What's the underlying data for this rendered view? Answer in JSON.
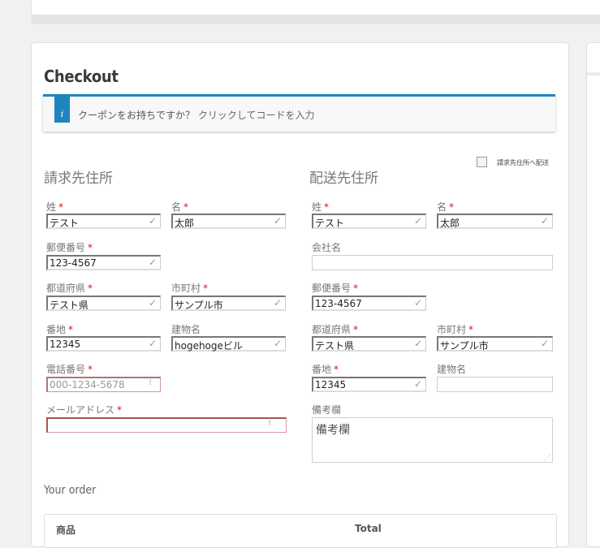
{
  "checkout": {
    "title": "Checkout",
    "coupon": {
      "text": "クーポンをお持ちですか？",
      "link": "クリックしてコードを入力"
    }
  },
  "billing": {
    "title": "請求先住所",
    "last_name": {
      "label": "姓",
      "value": "テスト"
    },
    "first_name": {
      "label": "名",
      "value": "太郎"
    },
    "postal": {
      "label": "郵便番号",
      "value": "123-4567"
    },
    "prefecture": {
      "label": "都道府県",
      "value": "テスト県"
    },
    "city": {
      "label": "市町村",
      "value": "サンプル市"
    },
    "address": {
      "label": "番地",
      "value": "12345"
    },
    "building": {
      "label": "建物名",
      "value": "hogehogeビル"
    },
    "phone": {
      "label": "電話番号",
      "value": "000-1234-5678"
    },
    "email": {
      "label": "メールアドレス",
      "value": ""
    }
  },
  "shipping": {
    "title": "配送先住所",
    "toggle_label": "請求先住所へ配送",
    "last_name": {
      "label": "姓",
      "value": "テスト"
    },
    "first_name": {
      "label": "名",
      "value": "太郎"
    },
    "company": {
      "label": "会社名",
      "value": ""
    },
    "postal": {
      "label": "郵便番号",
      "value": "123-4567"
    },
    "prefecture": {
      "label": "都道府県",
      "value": "テスト県"
    },
    "city": {
      "label": "市町村",
      "value": "サンプル市"
    },
    "address": {
      "label": "番地",
      "value": "12345"
    },
    "building": {
      "label": "建物名",
      "value": ""
    },
    "notes": {
      "label": "備考欄",
      "placeholder": "備考欄"
    }
  },
  "order": {
    "title": "Your order",
    "col_product": "商品",
    "col_total": "Total"
  },
  "icons": {
    "valid": "check-icon",
    "error": "exclamation-icon",
    "info": "info-icon"
  },
  "colors": {
    "accent": "#1e85be",
    "required": "#dd1111",
    "error_border": "#a55555"
  }
}
